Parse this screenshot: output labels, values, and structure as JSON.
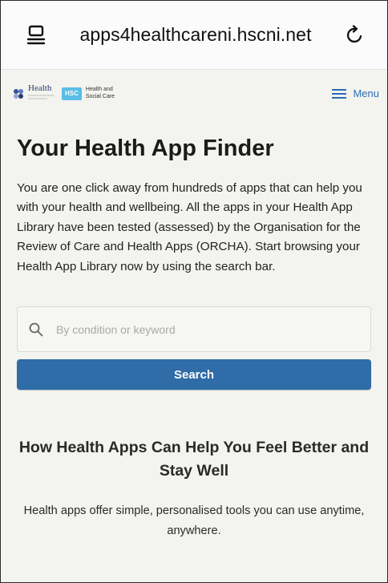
{
  "browser": {
    "url": "apps4healthcareni.hscni.net",
    "tabs_icon": "tabs-icon",
    "reload_icon": "reload-icon"
  },
  "header": {
    "dept_logo_text": "Health",
    "hsc_badge": "HSC",
    "hsc_line1": "Health and",
    "hsc_line2": "Social Care",
    "menu_label": "Menu"
  },
  "main": {
    "title": "Your Health App Finder",
    "intro": "You are one click away from hundreds of apps that can help you with your health and wellbeing. All the apps in your Health App Library have been tested (assessed) by the Organisation for the Review of Care and Health Apps (ORCHA). Start browsing your Health App Library now by using the search bar.",
    "search": {
      "placeholder": "By condition or keyword",
      "value": "",
      "button_label": "Search"
    },
    "section": {
      "title": "How Health Apps Can Help You Feel Better and Stay Well",
      "body": "Health apps offer simple, personalised tools you can use anytime, anywhere."
    }
  },
  "colors": {
    "primary": "#2f6ca8",
    "link": "#2a6db5",
    "hsc_blue": "#59bde6",
    "background": "#f3f3ef"
  }
}
